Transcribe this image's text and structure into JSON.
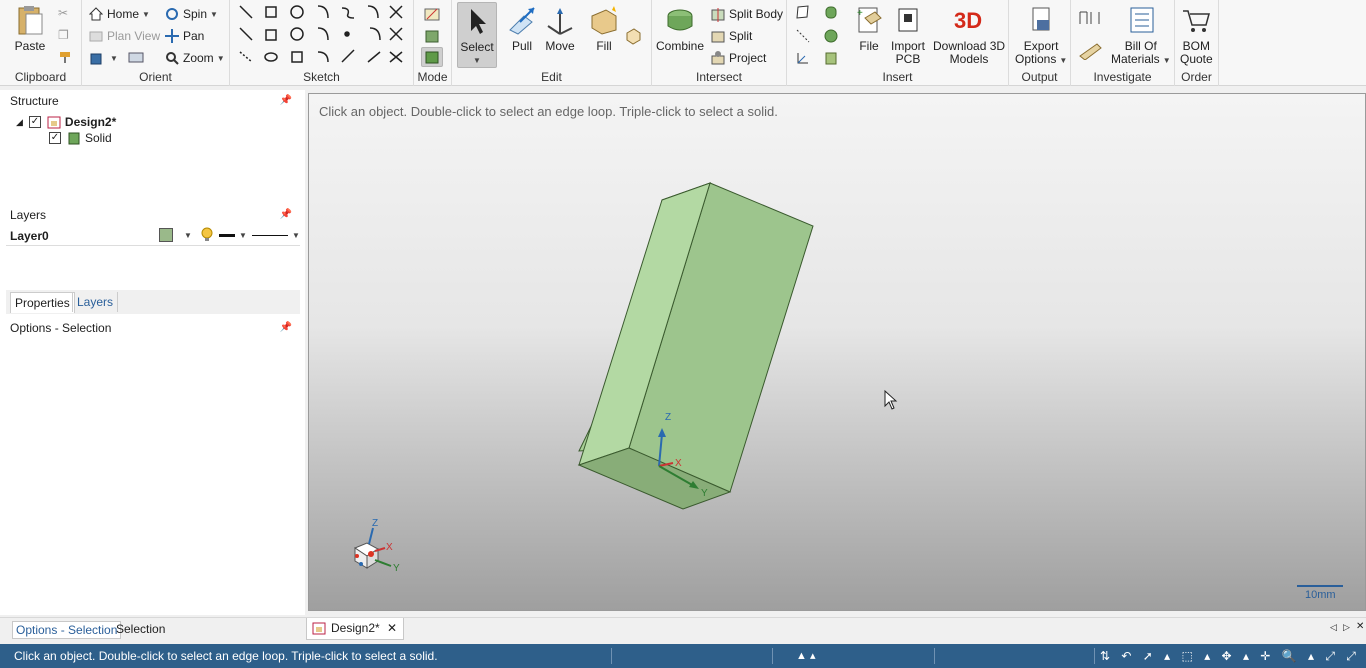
{
  "ribbon": {
    "clipboard": {
      "label": "Clipboard",
      "paste": "Paste"
    },
    "orient": {
      "label": "Orient",
      "home": "Home",
      "spin": "Spin",
      "plan_view": "Plan View",
      "pan": "Pan",
      "zoom": "Zoom"
    },
    "sketch": {
      "label": "Sketch"
    },
    "mode": {
      "label": "Mode"
    },
    "edit": {
      "label": "Edit",
      "select": "Select",
      "pull": "Pull",
      "move": "Move",
      "fill": "Fill"
    },
    "intersect": {
      "label": "Intersect",
      "combine": "Combine",
      "split_body": "Split Body",
      "split": "Split",
      "project": "Project"
    },
    "insert": {
      "label": "Insert",
      "file": "File",
      "import_pcb_1": "Import",
      "import_pcb_2": "PCB",
      "download_1": "Download 3D",
      "download_2": "Models"
    },
    "output": {
      "label": "Output",
      "export_1": "Export",
      "export_2": "Options"
    },
    "investigate": {
      "label": "Investigate",
      "bom_1": "Bill Of",
      "bom_2": "Materials"
    },
    "order": {
      "label": "Order",
      "quote_1": "BOM",
      "quote_2": "Quote"
    }
  },
  "structure": {
    "title": "Structure",
    "root": "Design2*",
    "child": "Solid"
  },
  "layers": {
    "title": "Layers",
    "layer_name": "Layer0",
    "layer_color": "#9ab98a"
  },
  "panel_tabs": [
    "Properties",
    "Layers"
  ],
  "options_title": "Options - Selection",
  "viewport": {
    "hint": "Click an object. Double-click to select an edge loop. Triple-click to select a solid.",
    "scale_label": "10mm",
    "axis_x": "X",
    "axis_y": "Y",
    "axis_z": "Z"
  },
  "bottom_tabs": {
    "left_1": "Options - Selection",
    "left_2": "Selection",
    "doc_tab": "Design2*"
  },
  "status": {
    "text": "Click an object. Double-click to select an edge loop. Triple-click to select a solid."
  },
  "colors": {
    "solid_fill": "#9dc58d",
    "accent": "#2e5f8a"
  }
}
